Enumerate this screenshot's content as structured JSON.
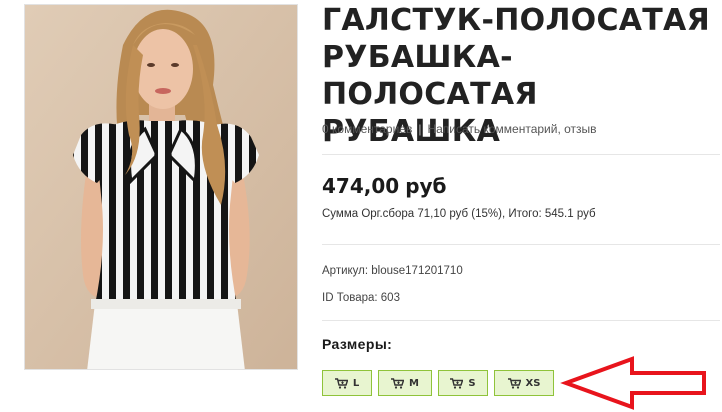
{
  "product": {
    "title": "ГАЛСТУК-ПОЛОСАТАЯ РУБАШКА-ПОЛОСАТАЯ РУБАШКА",
    "comments_link": "0 комментариев",
    "separator": "|",
    "write_review_link": "Написать комментарий, отзыв",
    "price_amount": "474,00",
    "price_currency": "руб",
    "fee_text": "Сумма Орг.сбора 71,10 руб (15%), Итого: 545.1 руб",
    "article": "Артикул: blouse171201710",
    "product_id": "ID Товара: 603"
  },
  "sizes": {
    "label": "Размеры:",
    "options": [
      "L",
      "M",
      "S",
      "XS"
    ]
  },
  "icons": {
    "size_button_icon": "cart-plus-icon",
    "annotation": "red-arrow-left-icon"
  },
  "colors": {
    "size_button_bg": "#e8f5d0",
    "size_button_border": "#8fc33a",
    "arrow": "#e8141c"
  }
}
